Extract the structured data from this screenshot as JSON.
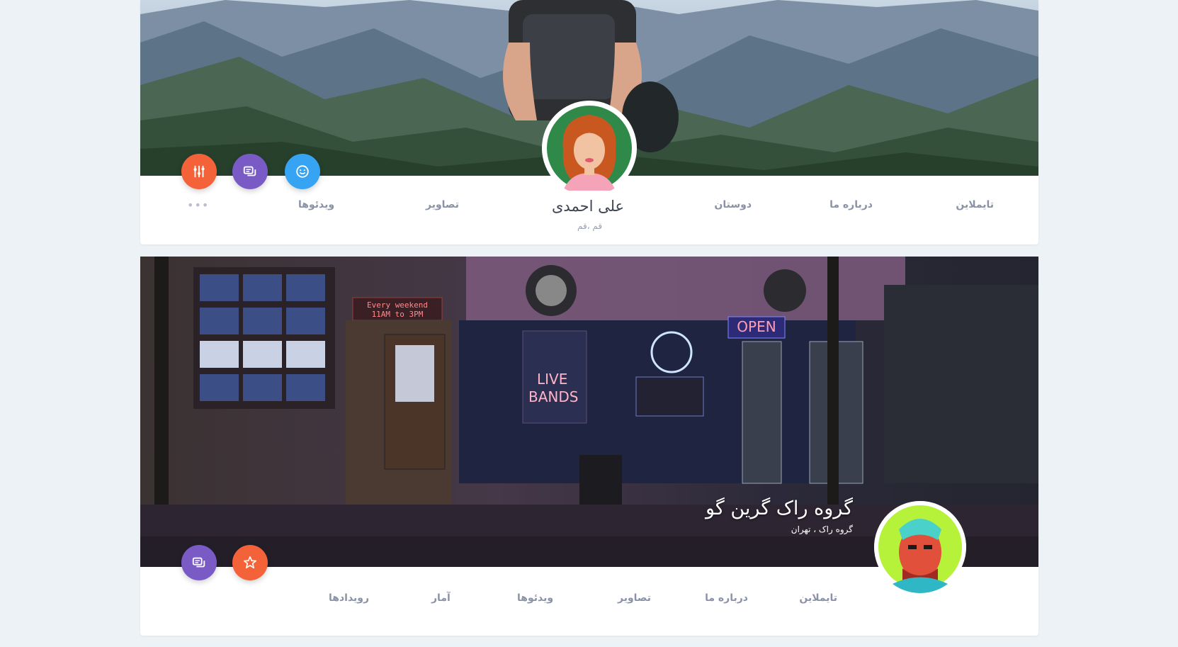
{
  "profile_card": {
    "name": "علی احمدی",
    "location": "قم ،قم",
    "tabs": {
      "timeline": "تایملاین",
      "about": "درباره ما",
      "friends": "دوستان",
      "photos": "تصاویر",
      "videos": "ویدئوها",
      "more": "•••"
    },
    "buttons": [
      "settings-sliders-icon",
      "chat-icon",
      "smile-icon"
    ]
  },
  "group_card": {
    "name": "گروه راک گرین گو",
    "subtitle": "گروه راک ، تهران",
    "tabs": {
      "timeline": "تایملاین",
      "about": "درباره ما",
      "photos": "تصاویر",
      "videos": "ویدئوها",
      "stats": "آمار",
      "events": "رویدادها"
    },
    "cover_signs": {
      "marquee": "Every weekend 11AM to 3PM",
      "live_bands": "LIVE BANDS",
      "open": "OPEN"
    },
    "buttons": [
      "chat-icon",
      "star-icon"
    ]
  },
  "colors": {
    "orange": "#f4623a",
    "purple": "#7a5bc6",
    "blue": "#36a4f3",
    "background": "#edf2f6"
  }
}
